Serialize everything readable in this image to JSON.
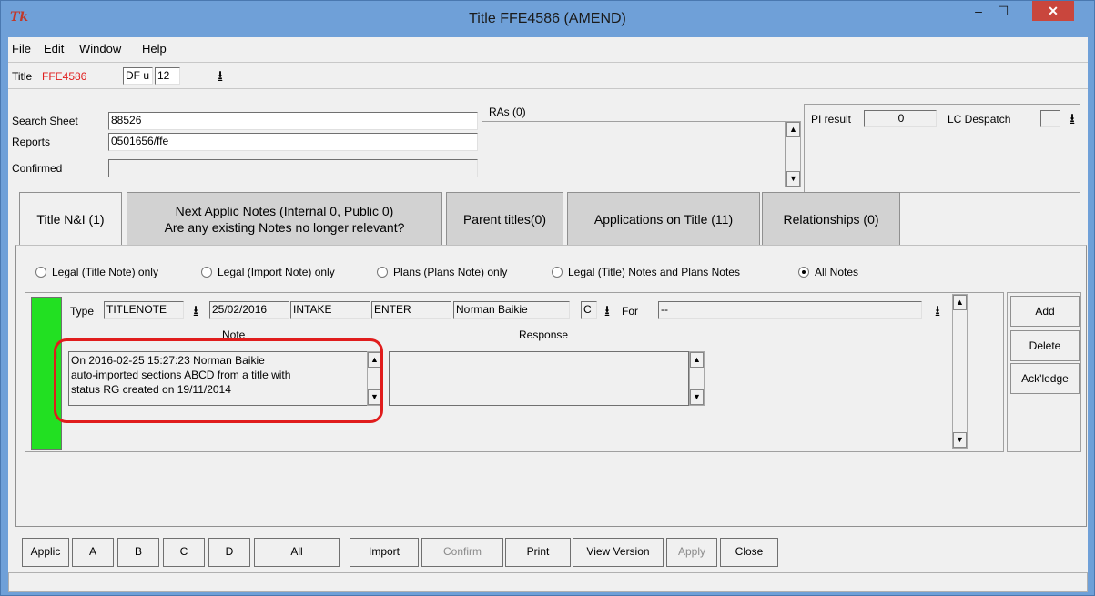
{
  "window": {
    "app_icon": "Tk",
    "title": "Title FFE4586 (AMEND)",
    "minimize": "–",
    "maximize": "☐",
    "close": "✕"
  },
  "menu": [
    "File",
    "Edit",
    "Window",
    "Help"
  ],
  "titlerow": {
    "label": "Title",
    "title_no": "FFE4586",
    "code_value": "DF u",
    "num_value": "12"
  },
  "header": {
    "search_sheet_label": "Search Sheet",
    "search_sheet_value": "88526",
    "reports_label": "Reports",
    "reports_value": "0501656/ffe",
    "confirmed_label": "Confirmed",
    "confirmed_value": "",
    "ras_label": "RAs (0)",
    "pi_result_label": "PI result",
    "pi_result_value": "0",
    "lc_despatch_label": "LC Despatch",
    "lc_despatch_value": ""
  },
  "tabs": [
    {
      "label": "Title N&I (1)",
      "active": true
    },
    {
      "label": "Next Applic Notes (Internal 0, Public 0)\nAre any existing Notes no longer relevant?",
      "active": false
    },
    {
      "label": "Parent titles(0)",
      "active": false
    },
    {
      "label": "Applications on Title (11)",
      "active": false
    },
    {
      "label": "Relationships (0)",
      "active": false
    }
  ],
  "filters": [
    {
      "label": "Legal (Title Note) only",
      "selected": false
    },
    {
      "label": "Legal (Import Note) only",
      "selected": false
    },
    {
      "label": "Plans (Plans Note) only",
      "selected": false
    },
    {
      "label": "Legal (Title) Notes and Plans Notes",
      "selected": false
    },
    {
      "label": "All Notes",
      "selected": true
    }
  ],
  "note": {
    "row_number": "1",
    "type_label": "Type",
    "type_value": "TITLENOTE",
    "date": "25/02/2016",
    "stage": "INTAKE",
    "action": "ENTER",
    "user": "Norman Baikie",
    "code": "C",
    "for_label": "For",
    "for_value": "--",
    "note_header": "Note",
    "response_header": "Response",
    "note_line1": "On 2016-02-25 15:27:23 Norman Baikie",
    "note_line2": "auto-imported sections ABCD from a title with",
    "note_line3": "status RG created on 19/11/2014",
    "response_text": ""
  },
  "side_buttons": [
    "Add",
    "Delete",
    "Ack'ledge"
  ],
  "bottom_buttons": [
    {
      "label": "Applic",
      "enabled": true
    },
    {
      "label": "A",
      "enabled": true
    },
    {
      "label": "B",
      "enabled": true
    },
    {
      "label": "C",
      "enabled": true
    },
    {
      "label": "D",
      "enabled": true
    },
    {
      "label": "All",
      "enabled": true
    },
    {
      "label": "Import",
      "enabled": true
    },
    {
      "label": "Confirm",
      "enabled": false
    },
    {
      "label": "Print",
      "enabled": true
    },
    {
      "label": "View Version",
      "enabled": true
    },
    {
      "label": "Apply",
      "enabled": false
    },
    {
      "label": "Close",
      "enabled": true
    }
  ],
  "colors": {
    "title_number": "#e01c1c",
    "row_indicator": "#22e022",
    "highlight": "#e01c1c",
    "titlebar": "#6fa0d8",
    "close_button": "#c9463d"
  },
  "icons": {
    "dropdown": "download-arrow-icon",
    "scroll_up": "triangle-up-icon",
    "scroll_down": "triangle-down-icon",
    "radio": "radio-button-icon"
  }
}
